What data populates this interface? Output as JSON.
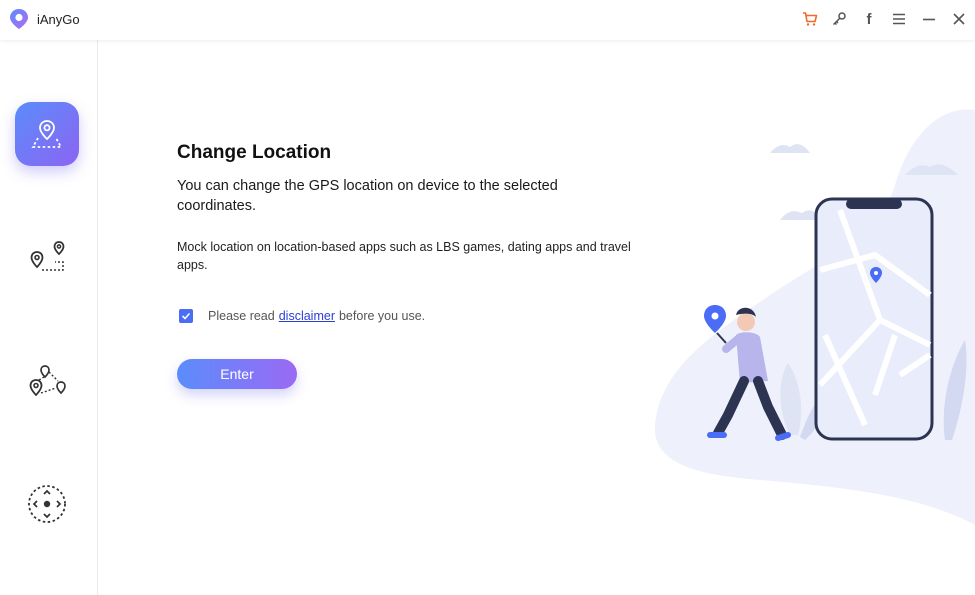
{
  "app": {
    "name": "iAnyGo"
  },
  "titlebar": {
    "icons": [
      "cart-icon",
      "key-icon",
      "facebook-icon",
      "menu-icon",
      "minimize-icon",
      "close-icon"
    ],
    "facebook_glyph": "f"
  },
  "sidebar": {
    "items": [
      {
        "name": "change-location",
        "icon": "map-pin-icon",
        "active": true
      },
      {
        "name": "two-spot-movement",
        "icon": "two-pins-route-icon",
        "active": false
      },
      {
        "name": "multi-spot-movement",
        "icon": "multi-pins-route-icon",
        "active": false
      },
      {
        "name": "joystick-movement",
        "icon": "joystick-icon",
        "active": false
      }
    ]
  },
  "main": {
    "title": "Change Location",
    "description": "You can change the GPS location on device to the selected coordinates.",
    "sub_description": "Mock location on location-based apps such as LBS games, dating apps and travel apps.",
    "agreement": {
      "checked": true,
      "prefix": "Please read",
      "link": "disclaimer",
      "suffix": "before you use."
    },
    "enter_label": "Enter"
  },
  "colors": {
    "accent_start": "#5b8cfb",
    "accent_end": "#9a6af4",
    "checkbox": "#4a6cf7",
    "cart": "#f06a2c",
    "link": "#2b3fd6"
  }
}
